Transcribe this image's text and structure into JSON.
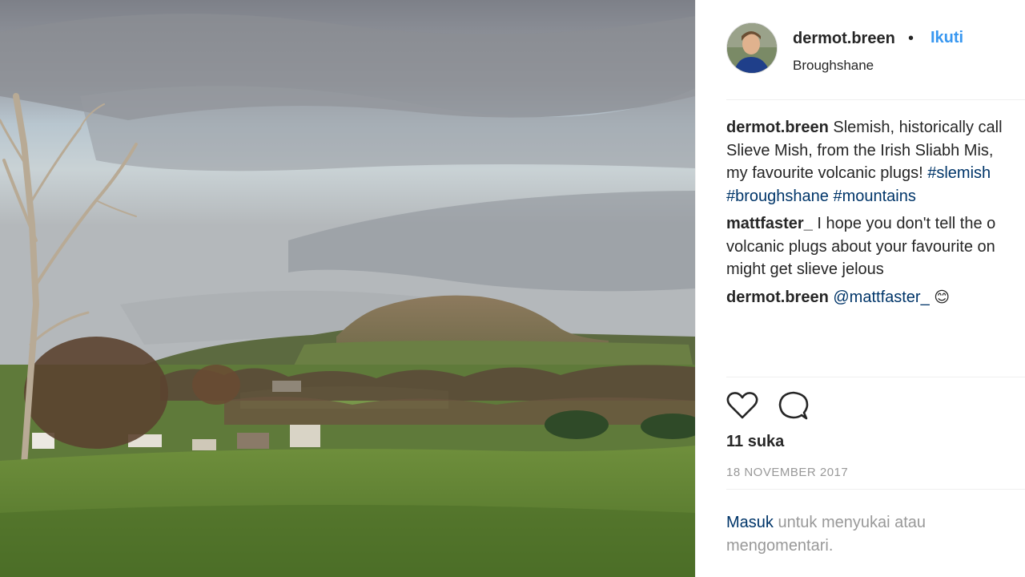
{
  "post": {
    "username": "dermot.breen",
    "follow_label": "Ikuti",
    "separator": "•",
    "location": "Broughshane"
  },
  "comments": [
    {
      "user": "dermot.breen",
      "text": " Slemish, historically call",
      "line2": "Slieve Mish, from the Irish Sliabh Mis,",
      "line3": "my favourite volcanic plugs! ",
      "hashtags": [
        "#slemish",
        "#broughshane",
        "#mountains"
      ]
    },
    {
      "user": "mattfaster_",
      "text": " I hope you don't tell the o",
      "line2": "volcanic plugs about your favourite on",
      "line3": "might get slieve jelous"
    },
    {
      "user": "dermot.breen",
      "mention": "@mattfaster_",
      "emoji": "😊"
    }
  ],
  "actions": {
    "like_icon": "heart-icon",
    "comment_icon": "comment-icon"
  },
  "likes_label": "11 suka",
  "date": "18 NOVEMBER 2017",
  "login": {
    "link": "Masuk",
    "text": " untuk menyukai atau",
    "line2": "mengomentari."
  },
  "colors": {
    "link_blue": "#3897f0",
    "hashtag_navy": "#003569",
    "muted_gray": "#999999",
    "text": "#262626"
  }
}
